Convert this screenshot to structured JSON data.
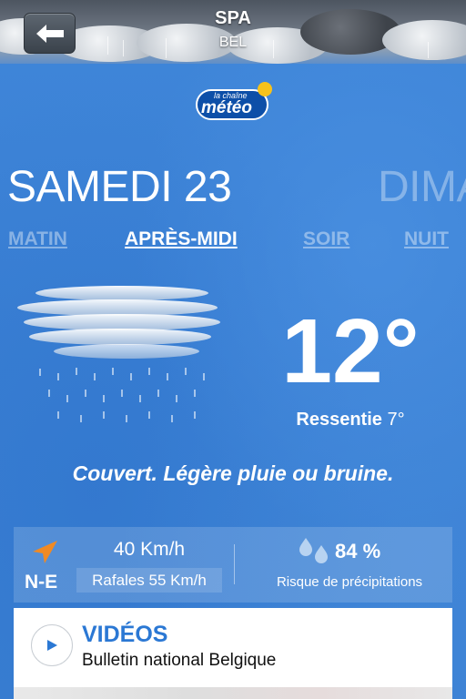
{
  "header": {
    "back_icon": "arrow-left-icon",
    "city": "SPA",
    "country": "BEL"
  },
  "logo": {
    "small_text": "la chaîne",
    "big_text": "météo"
  },
  "days": [
    {
      "label": "SAMEDI 23",
      "active": true
    },
    {
      "label": "DIMA",
      "active": false
    }
  ],
  "periods": [
    {
      "label": "MATIN",
      "active": false
    },
    {
      "label": "APRÈS-MIDI",
      "active": true
    },
    {
      "label": "SOIR",
      "active": false
    },
    {
      "label": "NUIT",
      "active": false
    }
  ],
  "weather": {
    "icon": "cloud-rain-icon",
    "temperature": "12°",
    "feels_like_label": "Ressentie",
    "feels_like_value": "7°",
    "description": "Couvert. Légère pluie ou bruine."
  },
  "wind": {
    "icon": "wind-direction-arrow-icon",
    "direction": "N-E",
    "speed": "40 Km/h",
    "gusts": "Rafales 55 Km/h"
  },
  "precipitation": {
    "icon": "rain-drops-icon",
    "value": "84 %",
    "label": "Risque de précipitations"
  },
  "videos": {
    "icon": "play-icon",
    "title": "VIDÉOS",
    "subtitle": "Bulletin national Belgique"
  },
  "colors": {
    "background": "#3a82d8",
    "accent_blue": "#2b78d4",
    "wind_arrow": "#f08a24"
  }
}
